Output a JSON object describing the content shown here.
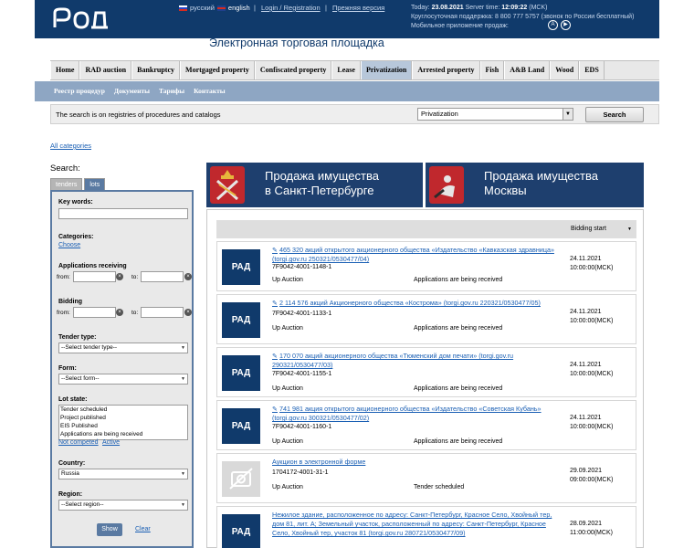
{
  "header": {
    "logo_text": "РАД",
    "lang_ru": "русский",
    "lang_en": "english",
    "login_link": "Login / Registration",
    "old_version_link": "Прежняя версия",
    "today_label": "Today:",
    "today_date": "23.08.2021",
    "server_time_label": "Server time:",
    "server_time": "12:09:22",
    "timezone": "(MCK)",
    "support_line": "Круглосуточная поддержка: 8 800 777 5757 (звонок по России бесплатный)",
    "mobile_app_label": "Мобильное приложение продаж:",
    "platform_title": "Электронная торговая площадка"
  },
  "nav": {
    "items": [
      "Home",
      "RAD auction",
      "Bankruptcy",
      "Mortgaged property",
      "Confiscated property",
      "Lease",
      "Privatization",
      "Arrested property",
      "Fish",
      "A&B Land",
      "Wood",
      "EDS"
    ],
    "active": "Privatization"
  },
  "subnav": {
    "items": [
      "Реестр процедур",
      "Документы",
      "Тарифы",
      "Контакты"
    ]
  },
  "searchbar": {
    "text": "The search is on registries of procedures and catalogs",
    "selected": "Privatization",
    "button": "Search"
  },
  "all_categories": "All categories",
  "sidebar": {
    "search_label": "Search:",
    "tab_tenders": "tenders",
    "tab_lots": "lots",
    "key_words_label": "Key words:",
    "categories_label": "Categories:",
    "choose_link": "Choose",
    "applications_label": "Applications receiving",
    "from_label": "from:",
    "to_label": "to:",
    "bidding_label": "Bidding",
    "tender_type_label": "Tender type:",
    "tender_type_value": "--Select tender type--",
    "form_label": "Form:",
    "form_value": "--Select form--",
    "lot_state_label": "Lot state:",
    "lot_states": [
      "Tender scheduled",
      "Project published",
      "EIS Published",
      "Applications are being received"
    ],
    "not_competed_link": "Not competed",
    "active_link": "Active",
    "country_label": "Country:",
    "country_value": "Russia",
    "region_label": "Region:",
    "region_value": "--Select region--",
    "show_button": "Show",
    "clear_link": "Clear"
  },
  "banners": [
    {
      "line1": "Продажа имущества",
      "line2": "в Санкт-Петербурге"
    },
    {
      "line1": "Продажа имущества",
      "line2": "Москвы"
    }
  ],
  "results": {
    "header_col": "Bidding start",
    "rows": [
      {
        "title": "465 320 акций открытого акционерного общества «Издательство «Кавказская здравница» (torgi.gov.ru 250321/0530477/04)",
        "code": "7F9042-4001-1148-1",
        "procedure": "Up Auction",
        "state": "Applications are being received",
        "date": "24.11.2021",
        "time": "10:00:00(MCK)"
      },
      {
        "title": "2 114 576 акций Акционерного общества «Кострома» (torgi.gov.ru 220321/0530477/05)",
        "code": "7F9042-4001-1133-1",
        "procedure": "Up Auction",
        "state": "Applications are being received",
        "date": "24.11.2021",
        "time": "10:00:00(MCK)"
      },
      {
        "title": "170 070 акций акционерного общества «Тюменский дом печати» (torgi.gov.ru 290321/0530477/03)",
        "code": "7F9042-4001-1155-1",
        "procedure": "Up Auction",
        "state": "Applications are being received",
        "date": "24.11.2021",
        "time": "10:00:00(MCK)"
      },
      {
        "title": "741 981 акция открытого акционерного общества «Издательство «Советская Кубань» (torgi.gov.ru 300321/0530477/02)",
        "code": "7F9042-4001-1160-1",
        "procedure": "Up Auction",
        "state": "Applications are being received",
        "date": "24.11.2021",
        "time": "10:00:00(MCK)"
      },
      {
        "title": "Аукцион в электронной форме",
        "code": "1704172-4001-31-1",
        "procedure": "Up Auction",
        "state": "Tender scheduled",
        "date": "29.09.2021",
        "time": "09:00:00(MCK)"
      },
      {
        "title": "Нежилое здание, расположенное по адресу: Санкт-Петербург, Красное Село, Хвойный тер, дом 81, лит. А; Земельный участок, расположенный по адресу: Санкт-Петербург, Красное Село, Хвойный тер, участок 81 (torgi.gov.ru 280721/0530477/09)",
        "code": "",
        "procedure": "",
        "state": "",
        "date": "28.09.2021",
        "time": "11:00:00(MCK)"
      }
    ]
  },
  "colors": {
    "header_bg": "#103a6b",
    "subnav_bg": "#8ea6c3",
    "link": "#1a5fb4"
  }
}
